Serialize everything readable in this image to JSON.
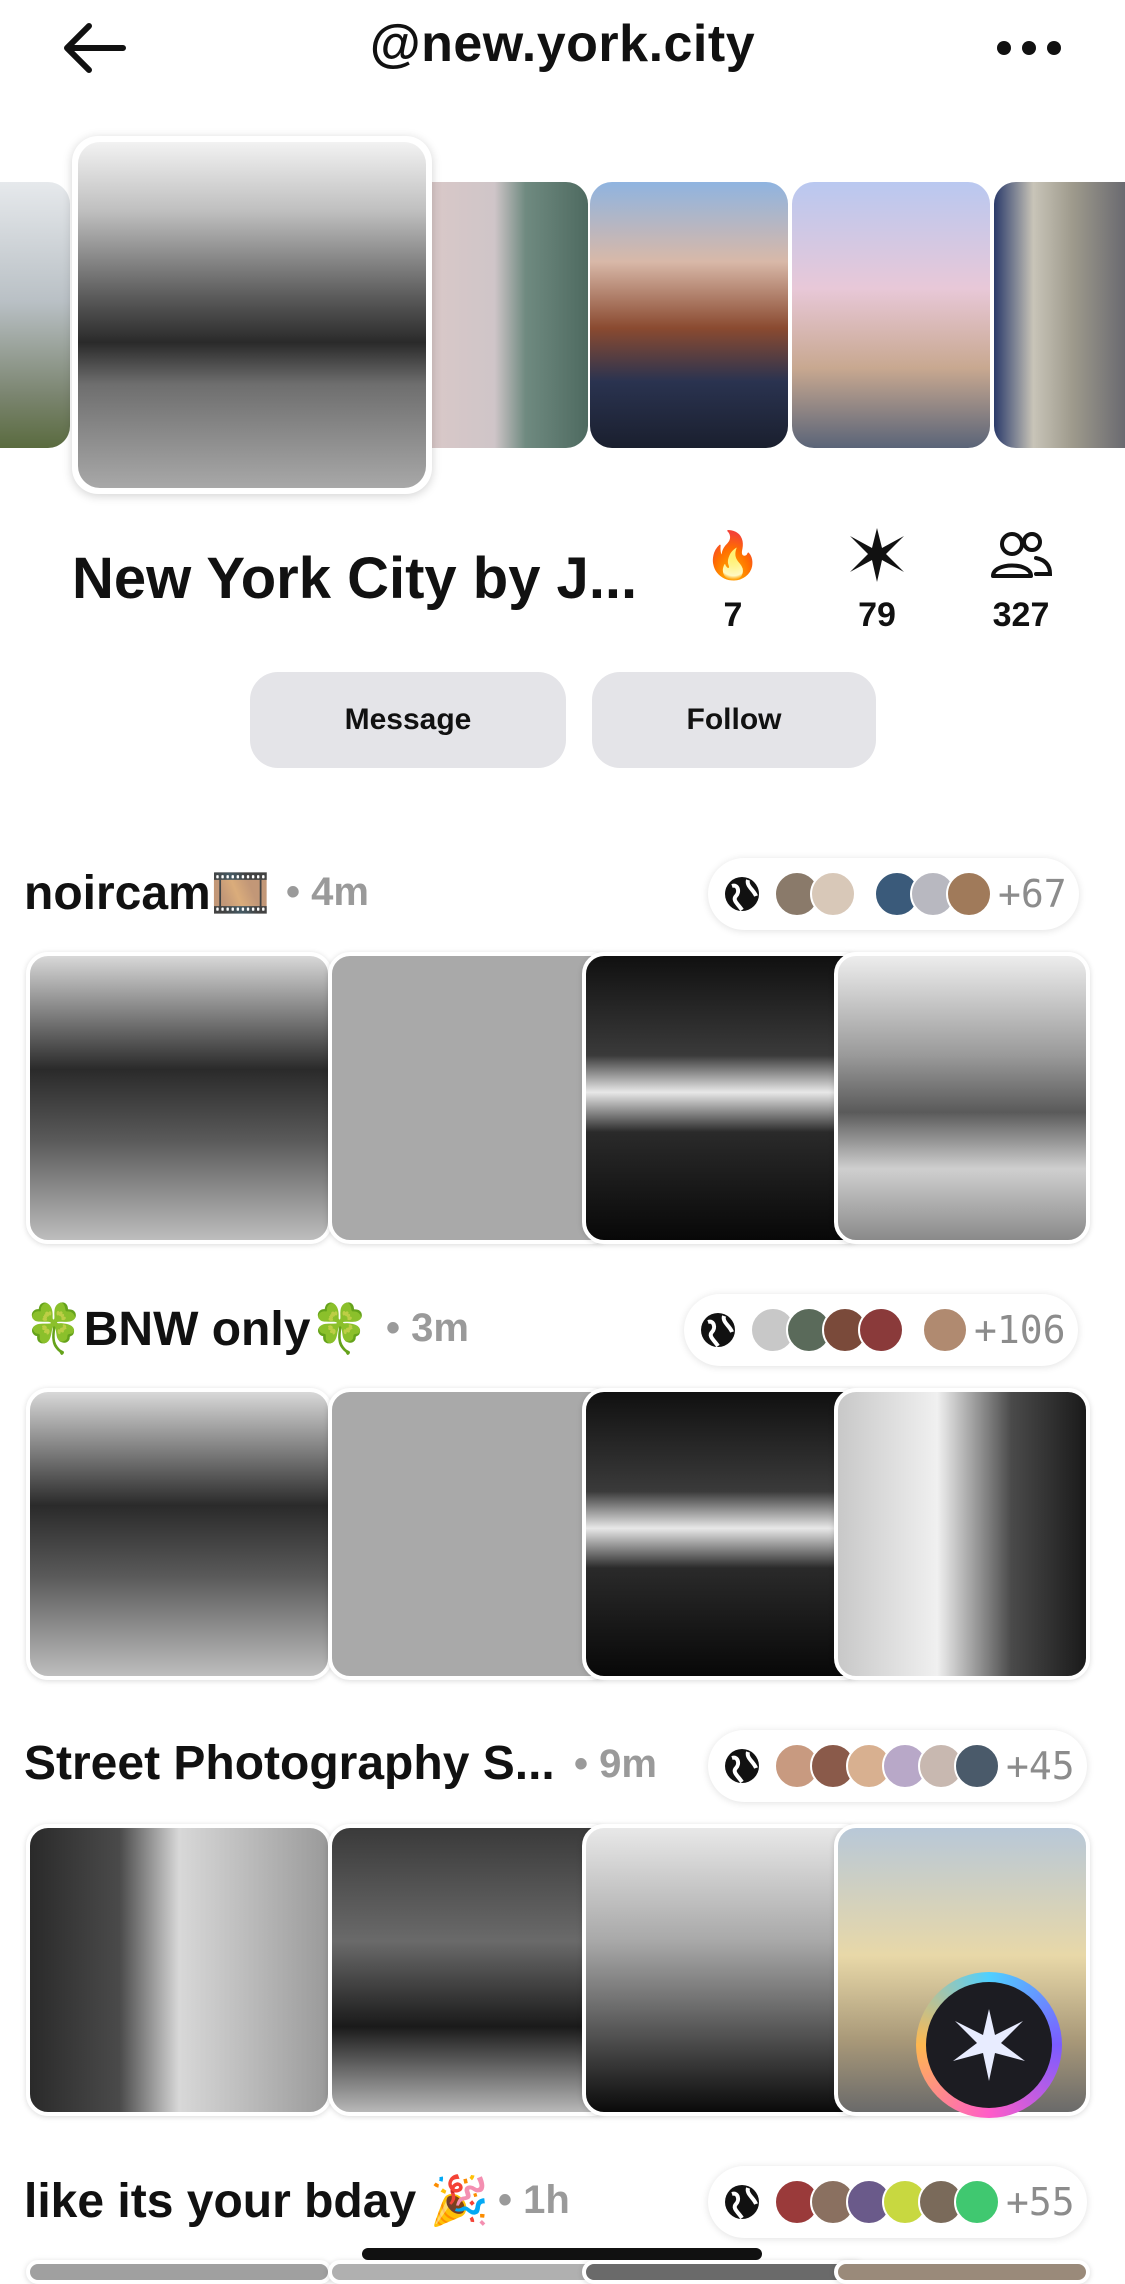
{
  "header": {
    "title": "@new.york.city",
    "back_icon": "arrow-left-icon",
    "more_icon": "ellipsis-icon"
  },
  "profile": {
    "name": "New York City by J...",
    "stats": [
      {
        "icon": "fire-icon",
        "value": "7"
      },
      {
        "icon": "sparkle-icon",
        "value": "79"
      },
      {
        "icon": "people-icon",
        "value": "327"
      }
    ],
    "message_label": "Message",
    "follow_label": "Follow"
  },
  "groups": [
    {
      "name": "noircam🎞️",
      "time": "• 4m",
      "extra": "+67"
    },
    {
      "name": "🍀BNW only🍀",
      "time": "• 3m",
      "extra": "+106"
    },
    {
      "name": "Street Photography S...",
      "time": "• 9m",
      "extra": "+45"
    },
    {
      "name": "like its your bday 🎉",
      "time": "• 1h",
      "extra": "+55"
    }
  ],
  "colors": {
    "button_bg": "#e4e4e8",
    "muted_text": "#9a9a9a",
    "fab_gradient": "#7b5cff"
  }
}
